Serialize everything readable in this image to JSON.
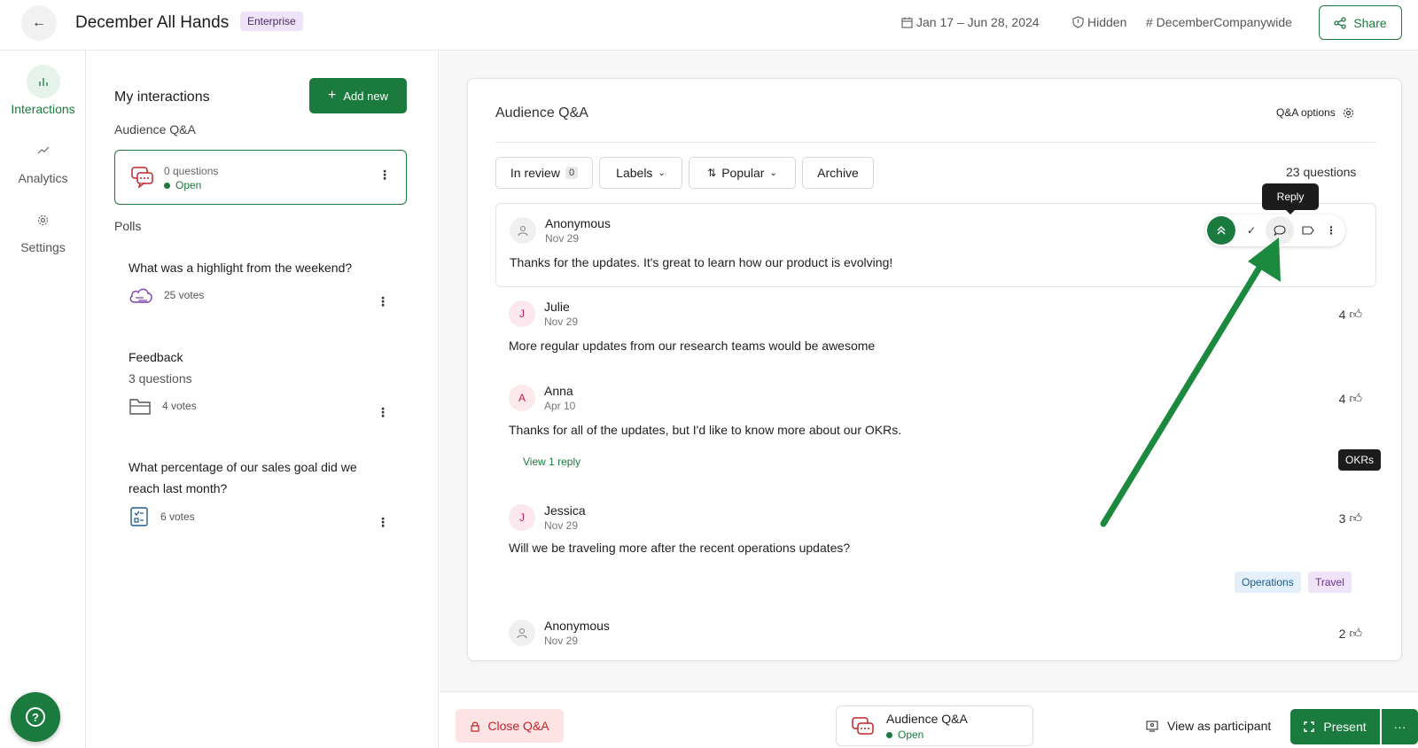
{
  "topbar": {
    "title": "December All Hands",
    "badge": "Enterprise",
    "date_range": "Jan 17 – Jun 28, 2024",
    "visibility": "Hidden",
    "channel": "# DecemberCompanywide",
    "share_label": "Share"
  },
  "leftnav": {
    "items": [
      {
        "label": "Interactions",
        "icon": "bar-chart-icon"
      },
      {
        "label": "Analytics",
        "icon": "trend-icon"
      },
      {
        "label": "Settings",
        "icon": "gear-icon"
      }
    ],
    "help_icon": "question-icon"
  },
  "panel": {
    "heading": "My interactions",
    "add_new_label": "Add new",
    "qa_section_label": "Audience Q&A",
    "qa_card": {
      "count": "0 questions",
      "status": "Open"
    },
    "polls_label": "Polls",
    "polls": [
      {
        "title": "What was a highlight from the weekend?",
        "subtitle": "",
        "votes": "25 votes",
        "icon": "word-cloud-icon"
      },
      {
        "title": "Feedback",
        "subtitle": "3 questions",
        "votes": "4 votes",
        "icon": "folder-icon"
      },
      {
        "title": "What percentage of our sales goal did we reach last month?",
        "subtitle": "",
        "votes": "6 votes",
        "icon": "checklist-icon"
      }
    ]
  },
  "qa": {
    "title": "Audience Q&A",
    "options_label": "Q&A options",
    "filters": {
      "in_review": "In review",
      "in_review_count": "0",
      "labels": "Labels",
      "sort": "Popular",
      "archive": "Archive"
    },
    "total": "23 questions",
    "reply_tooltip": "Reply",
    "questions": [
      {
        "name": "Anonymous",
        "date": "Nov 29",
        "text": "Thanks for the updates. It's great to learn how our product is evolving!",
        "votes": "",
        "initial": ""
      },
      {
        "name": "Julie",
        "date": "Nov 29",
        "text": "More regular updates from our research teams would be awesome",
        "votes": "4",
        "initial": "J"
      },
      {
        "name": "Anna",
        "date": "Apr 10",
        "text": "Thanks for all of the updates, but I'd like to know more about our OKRs.",
        "votes": "4",
        "initial": "A",
        "reply_link": "View 1 reply",
        "tag": "OKRs"
      },
      {
        "name": "Jessica",
        "date": "Nov 29",
        "text": "Will we be traveling more after the recent operations updates?",
        "votes": "3",
        "initial": "J",
        "labels": [
          "Operations",
          "Travel"
        ]
      },
      {
        "name": "Anonymous",
        "date": "Nov 29",
        "text": "",
        "votes": "2",
        "initial": ""
      }
    ]
  },
  "bottombar": {
    "close_label": "Close Q&A",
    "card_title": "Audience Q&A",
    "card_status": "Open",
    "view_participant": "View as participant",
    "present_label": "Present",
    "more_label": "···"
  },
  "colors": {
    "accent": "#1b7a3e",
    "danger": "#c0232a",
    "badge_bg": "#efe3f8"
  }
}
